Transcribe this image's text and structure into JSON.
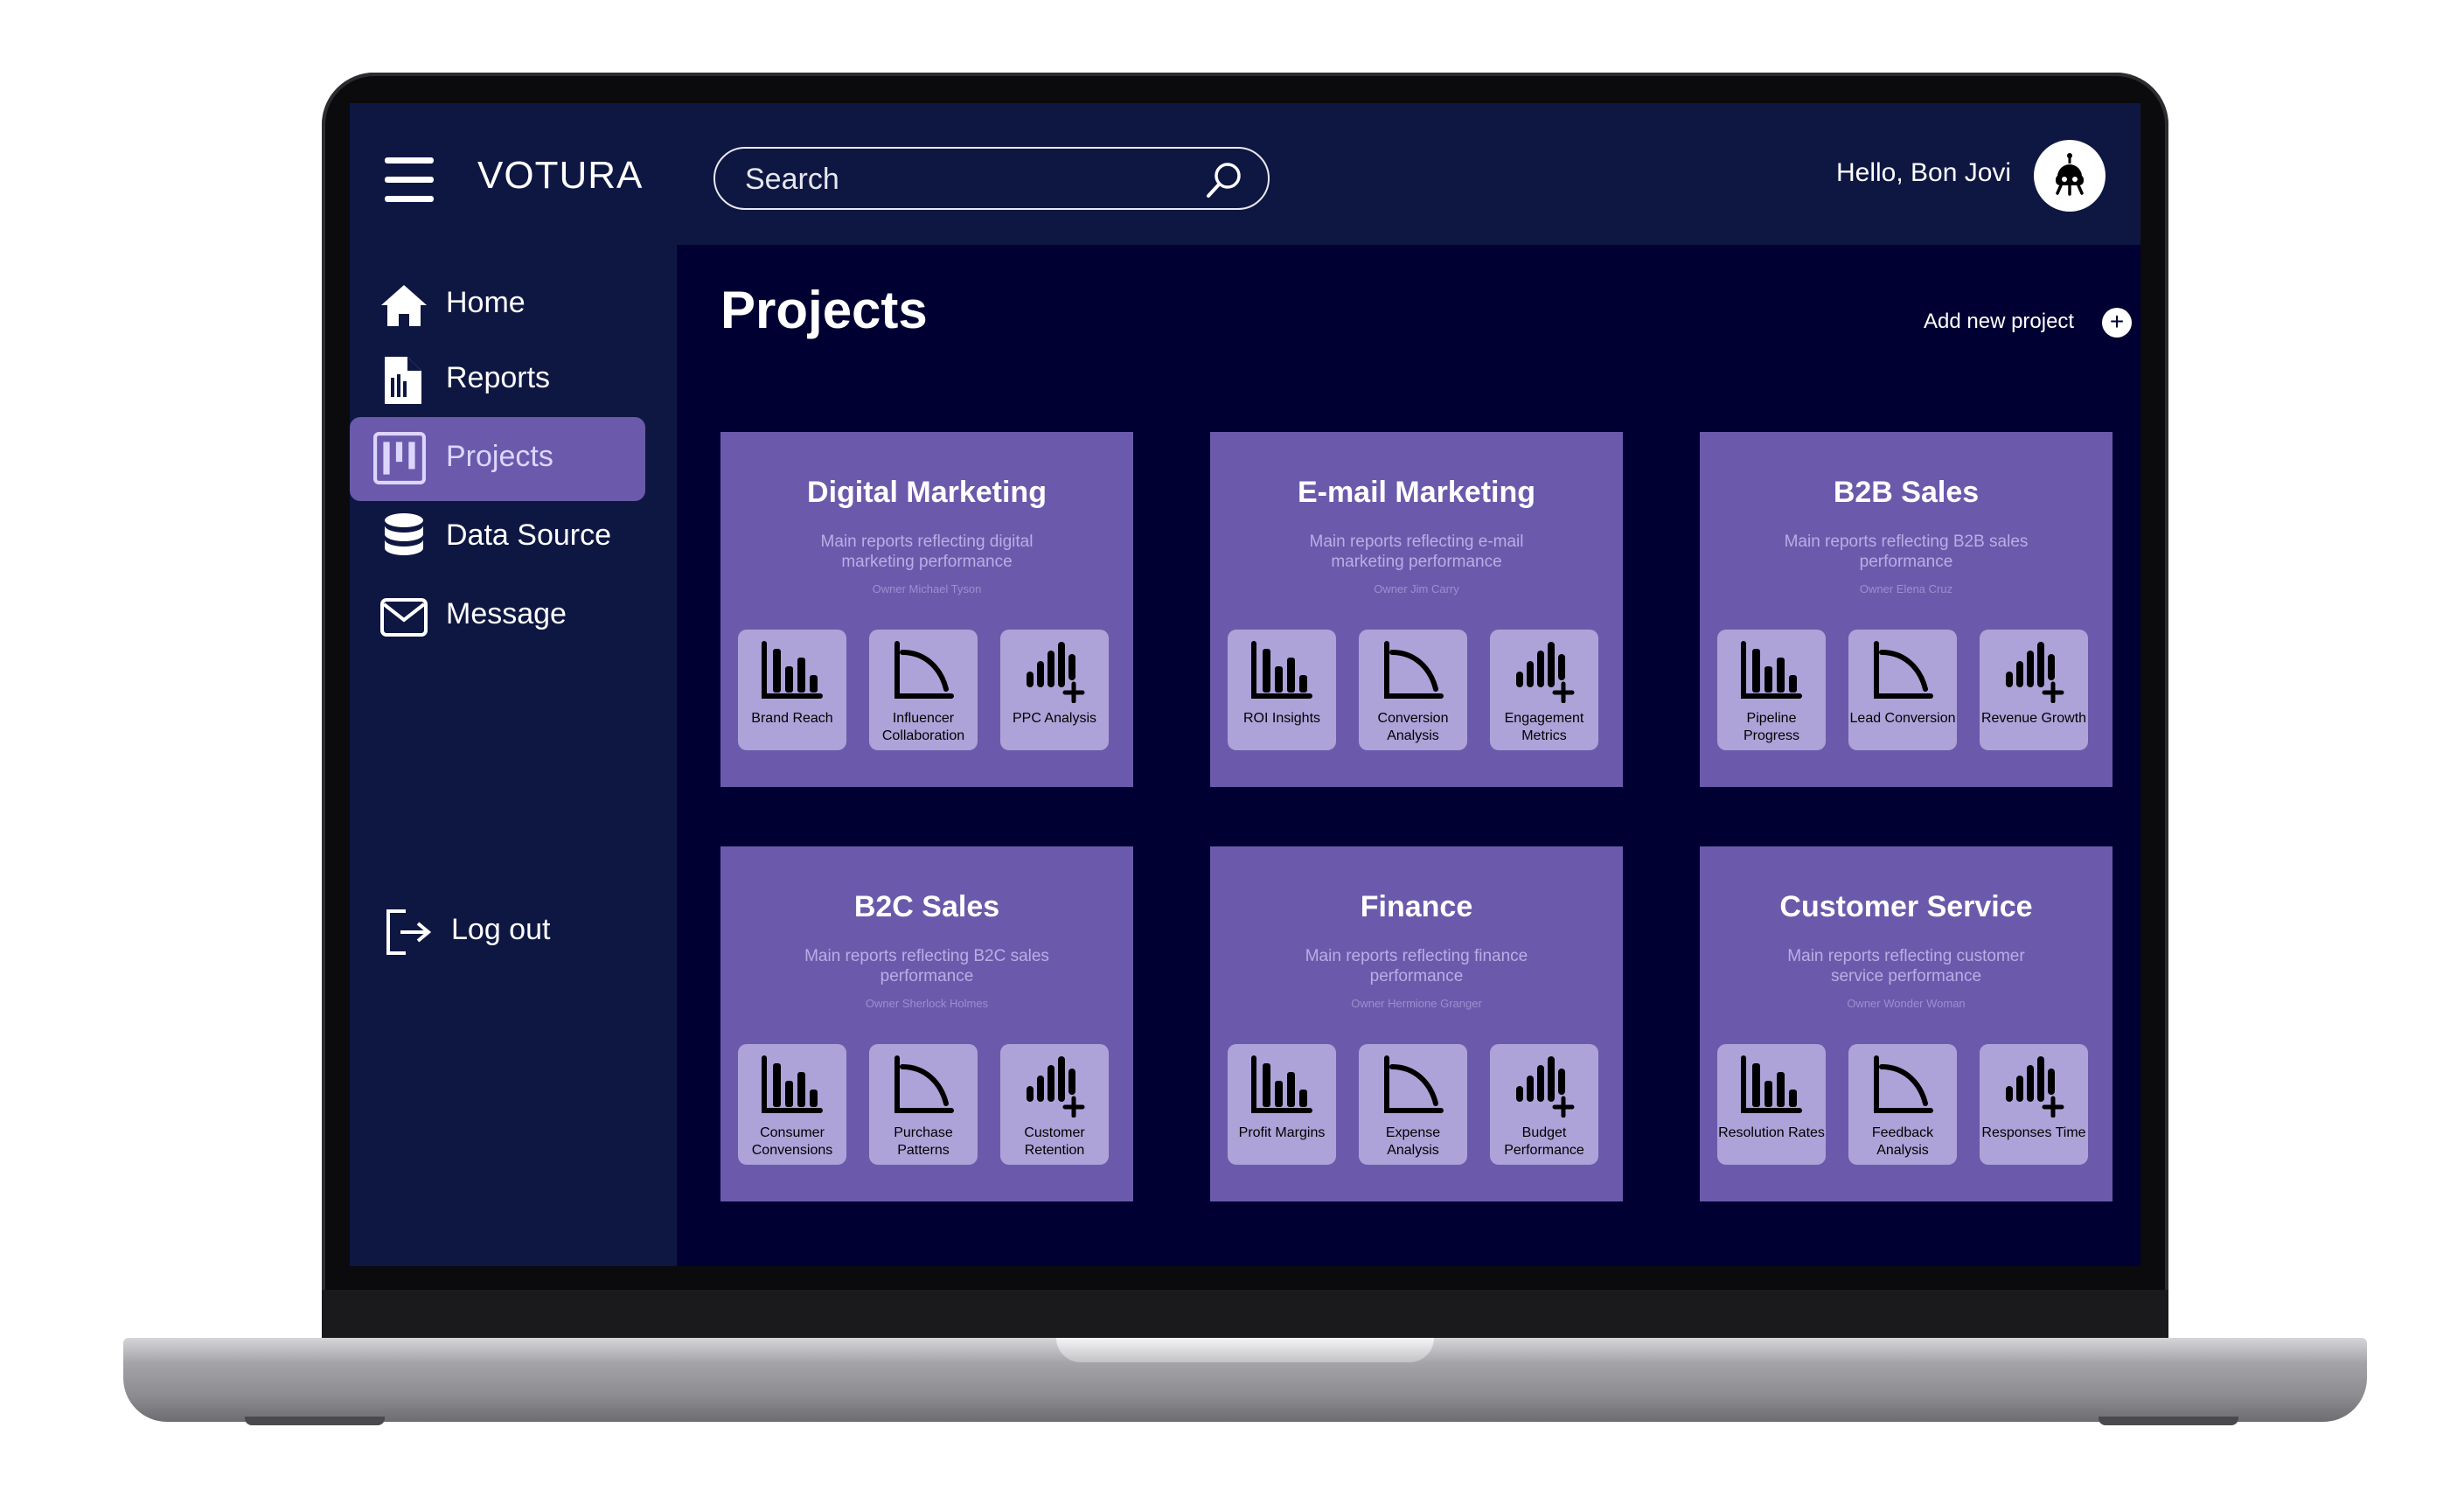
{
  "app": {
    "brand": "VOTURA",
    "greeting": "Hello, Bon Jovi"
  },
  "search": {
    "placeholder": "Search"
  },
  "sidebar": {
    "items": [
      {
        "label": "Home",
        "icon": "home-icon"
      },
      {
        "label": "Reports",
        "icon": "report-icon"
      },
      {
        "label": "Projects",
        "icon": "kanban-icon",
        "active": true
      },
      {
        "label": "Data Source",
        "icon": "database-icon"
      },
      {
        "label": "Message",
        "icon": "mail-icon"
      }
    ],
    "logout": "Log out"
  },
  "main": {
    "title": "Projects",
    "add_label": "Add new project",
    "add_symbol": "+"
  },
  "projects": [
    {
      "title": "Digital Marketing",
      "desc": "Main reports reflecting digital marketing performance",
      "owner": "Owner Michael Tyson",
      "tiles": [
        {
          "label": "Brand Reach",
          "icon": "bar-chart-icon"
        },
        {
          "label": "Influencer Collaboration",
          "icon": "curve-chart-icon"
        },
        {
          "label": "PPC Analysis",
          "icon": "add-chart-icon"
        }
      ]
    },
    {
      "title": "E-mail Marketing",
      "desc": "Main reports reflecting e-mail marketing performance",
      "owner": "Owner Jim Carry",
      "tiles": [
        {
          "label": "ROI Insights",
          "icon": "bar-chart-icon"
        },
        {
          "label": "Conversion Analysis",
          "icon": "curve-chart-icon"
        },
        {
          "label": "Engagement Metrics",
          "icon": "add-chart-icon"
        }
      ]
    },
    {
      "title": "B2B Sales",
      "desc": "Main reports reflecting B2B sales performance",
      "owner": "Owner Elena Cruz",
      "tiles": [
        {
          "label": "Pipeline Progress",
          "icon": "bar-chart-icon"
        },
        {
          "label": "Lead Conversion",
          "icon": "curve-chart-icon"
        },
        {
          "label": "Revenue Growth",
          "icon": "add-chart-icon"
        }
      ]
    },
    {
      "title": "B2C Sales",
      "desc": "Main reports reflecting B2C sales performance",
      "owner": "Owner Sherlock Holmes",
      "tiles": [
        {
          "label": "Consumer Convensions",
          "icon": "bar-chart-icon"
        },
        {
          "label": "Purchase Patterns",
          "icon": "curve-chart-icon"
        },
        {
          "label": "Customer Retention",
          "icon": "add-chart-icon"
        }
      ]
    },
    {
      "title": "Finance",
      "desc": "Main reports reflecting finance performance",
      "owner": "Owner Hermione Granger",
      "tiles": [
        {
          "label": "Profit Margins",
          "icon": "bar-chart-icon"
        },
        {
          "label": "Expense Analysis",
          "icon": "curve-chart-icon"
        },
        {
          "label": "Budget Performance",
          "icon": "add-chart-icon"
        }
      ]
    },
    {
      "title": "Customer Service",
      "desc": "Main reports reflecting customer service performance",
      "owner": "Owner Wonder Woman",
      "tiles": [
        {
          "label": "Resolution Rates",
          "icon": "bar-chart-icon"
        },
        {
          "label": "Feedback Analysis",
          "icon": "curve-chart-icon"
        },
        {
          "label": "Responses Time",
          "icon": "add-chart-icon"
        }
      ]
    }
  ]
}
